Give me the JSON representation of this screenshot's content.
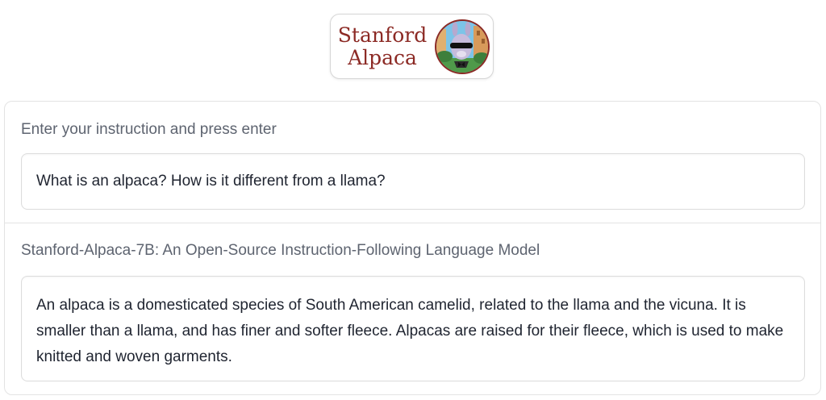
{
  "logo": {
    "line1": "Stanford",
    "line2": "Alpaca",
    "text_color": "#8c2a25"
  },
  "input_section": {
    "label": "Enter your instruction and press enter",
    "value": "What is an alpaca? How is it different from a llama?"
  },
  "output_section": {
    "label": "Stanford-Alpaca-7B: An Open-Source Instruction-Following Language Model",
    "value": "An alpaca is a domesticated species of South American camelid, related to the llama and the vicuna. It is smaller than a llama, and has finer and softer fleece. Alpacas are raised for their fleece, which is used to make knitted and woven garments."
  }
}
